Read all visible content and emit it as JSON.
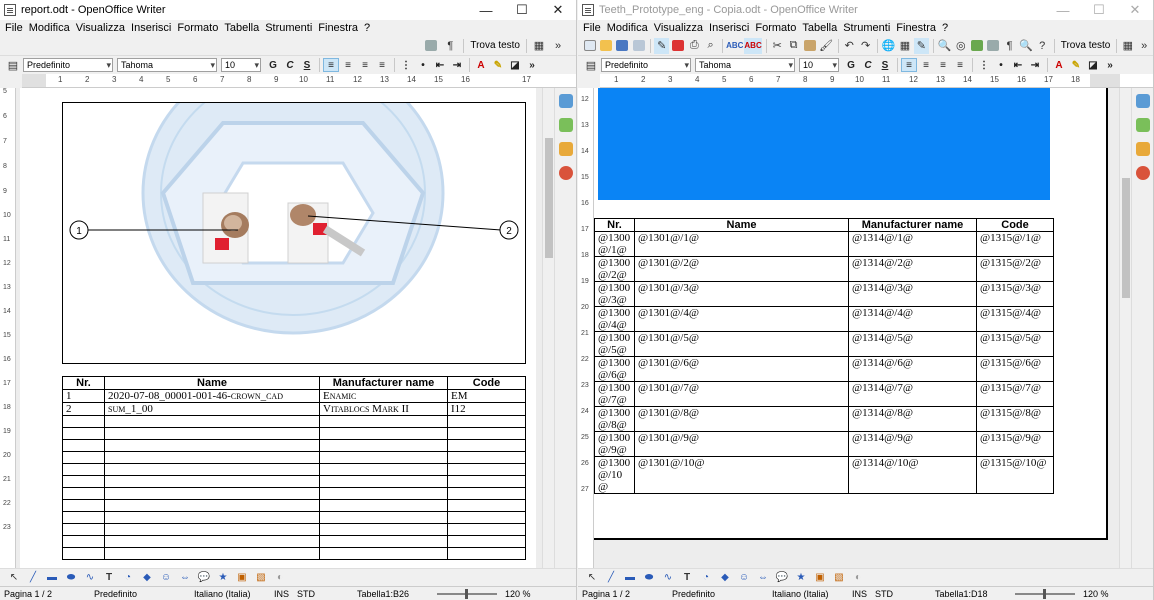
{
  "left": {
    "title": "report.odt - OpenOffice Writer",
    "menu": [
      "File",
      "Modifica",
      "Visualizza",
      "Inserisci",
      "Formato",
      "Tabella",
      "Strumenti",
      "Finestra",
      "?"
    ],
    "find_text": "Trova testo",
    "style": "Predefinito",
    "font": "Tahoma",
    "size": "10",
    "fmt_bold": "G",
    "fmt_italic": "C",
    "fmt_underline": "S",
    "ruler_ticks": [
      "1",
      "2",
      "3",
      "4",
      "5",
      "6",
      "7",
      "8",
      "9",
      "10",
      "11",
      "12",
      "13",
      "14",
      "15",
      "16",
      "17"
    ],
    "vruler_ticks": [
      "5",
      "6",
      "7",
      "8",
      "9",
      "10",
      "11",
      "12",
      "13",
      "14",
      "15",
      "16",
      "17",
      "18",
      "19",
      "20",
      "21",
      "22",
      "23"
    ],
    "callouts": [
      "1",
      "2"
    ],
    "table": {
      "headers": [
        "Nr.",
        "Name",
        "Manufacturer name",
        "Code"
      ],
      "rows": [
        [
          "1",
          "2020-07-08_00001-001-46-crown_cad",
          "Enamic",
          "EM"
        ],
        [
          "2",
          "sum_1_00",
          "Vitablocs Mark II",
          "I12"
        ]
      ]
    },
    "status": {
      "page": "Pagina 1 / 2",
      "style": "Predefinito",
      "lang": "Italiano (Italia)",
      "ins": "INS",
      "std": "STD",
      "cell": "Tabella1:B26",
      "zoom": "120 %"
    }
  },
  "right": {
    "title": "Teeth_Prototype_eng - Copia.odt - OpenOffice Writer",
    "menu": [
      "File",
      "Modifica",
      "Visualizza",
      "Inserisci",
      "Formato",
      "Tabella",
      "Strumenti",
      "Finestra",
      "?"
    ],
    "find_text": "Trova testo",
    "style": "Predefinito",
    "font": "Tahoma",
    "size": "10",
    "fmt_bold": "G",
    "fmt_italic": "C",
    "fmt_underline": "S",
    "ruler_ticks": [
      "1",
      "2",
      "3",
      "4",
      "5",
      "6",
      "7",
      "8",
      "9",
      "10",
      "11",
      "12",
      "13",
      "14",
      "15",
      "16",
      "17",
      "18"
    ],
    "vruler_ticks": [
      "12",
      "13",
      "14",
      "15",
      "16",
      "17",
      "18",
      "19",
      "20",
      "21",
      "22",
      "23",
      "24",
      "25",
      "26",
      "27"
    ],
    "blue_block_color": "#0a84f5",
    "table": {
      "headers": [
        "Nr.",
        "Name",
        "Manufacturer name",
        "Code"
      ],
      "rows": [
        [
          "@1300\n@/1@",
          "@1301@/1@",
          "@1314@/1@",
          "@1315@/1@"
        ],
        [
          "@1300\n@/2@",
          "@1301@/2@",
          "@1314@/2@",
          "@1315@/2@"
        ],
        [
          "@1300\n@/3@",
          "@1301@/3@",
          "@1314@/3@",
          "@1315@/3@"
        ],
        [
          "@1300\n@/4@",
          "@1301@/4@",
          "@1314@/4@",
          "@1315@/4@"
        ],
        [
          "@1300\n@/5@",
          "@1301@/5@",
          "@1314@/5@",
          "@1315@/5@"
        ],
        [
          "@1300\n@/6@",
          "@1301@/6@",
          "@1314@/6@",
          "@1315@/6@"
        ],
        [
          "@1300\n@/7@",
          "@1301@/7@",
          "@1314@/7@",
          "@1315@/7@"
        ],
        [
          "@1300\n@/8@",
          "@1301@/8@",
          "@1314@/8@",
          "@1315@/8@"
        ],
        [
          "@1300\n@/9@",
          "@1301@/9@",
          "@1314@/9@",
          "@1315@/9@"
        ],
        [
          "@1300\n@/10\n@",
          "@1301@/10@",
          "@1314@/10@",
          "@1315@/10@"
        ]
      ]
    },
    "status": {
      "page": "Pagina 1 / 2",
      "style": "Predefinito",
      "lang": "Italiano (Italia)",
      "ins": "INS",
      "std": "STD",
      "cell": "Tabella1:D18",
      "zoom": "120 %"
    }
  }
}
